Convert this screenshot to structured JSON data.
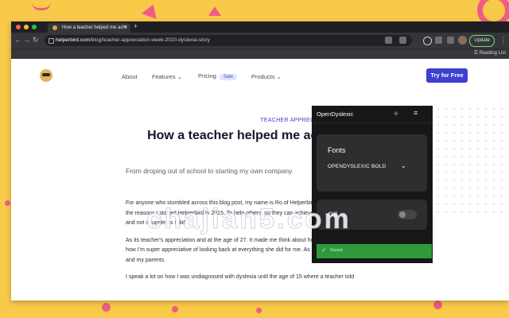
{
  "browser": {
    "tab_title": "How a teacher helped me achi",
    "tab_close": "×",
    "new_tab": "+",
    "url_host": "helperbird.com",
    "url_path": "/blog/teacher-appreciation-week-2020-dyslexia-story",
    "update_label": "Update",
    "more_label": "⋮",
    "reading_list": "Reading List"
  },
  "site": {
    "nav": {
      "about": "About",
      "features": "Features",
      "pricing": "Pricing",
      "sale_badge": "Sale",
      "products": "Products",
      "cta": "Try for Free"
    },
    "article": {
      "kicker": "TEACHER APPRECIATION WEEK",
      "title": "How a teacher helped me ac potential.",
      "subtitle": "From droping out of school to starting my own company.",
      "paragraphs": [
        "For anyone who stumbled across this blog post, my name is Ro of Helperbird. I also have dyslexia. It was one of the reasons I started Helperbird in 2015. To help others, so they can achieve their full potential in the classroom and not struggle as I did.",
        "As its teacher's appreciation and at the age of 27. It made me think about how one teacher changed my life and how I'm super appreciative of looking back at everything she did for me. As I know, I wouldn't be here without her and my parents.",
        "I speak a lot on how I was undiagnosed with dyslexia until the age of 15 where a teacher told"
      ]
    }
  },
  "popup": {
    "title": "OpenDyslexic",
    "fonts_label": "Fonts",
    "font_selected": "OPENDYSLEXIC BOLD",
    "toggle_label": "Off",
    "toggle_state": "off",
    "saved_text": "Saved"
  },
  "watermark": "chajian5.com",
  "colors": {
    "background": "#f9c94a",
    "accent": "#3d3fd1",
    "popup_bg": "#171717",
    "saved_green": "#2f9a3c"
  }
}
